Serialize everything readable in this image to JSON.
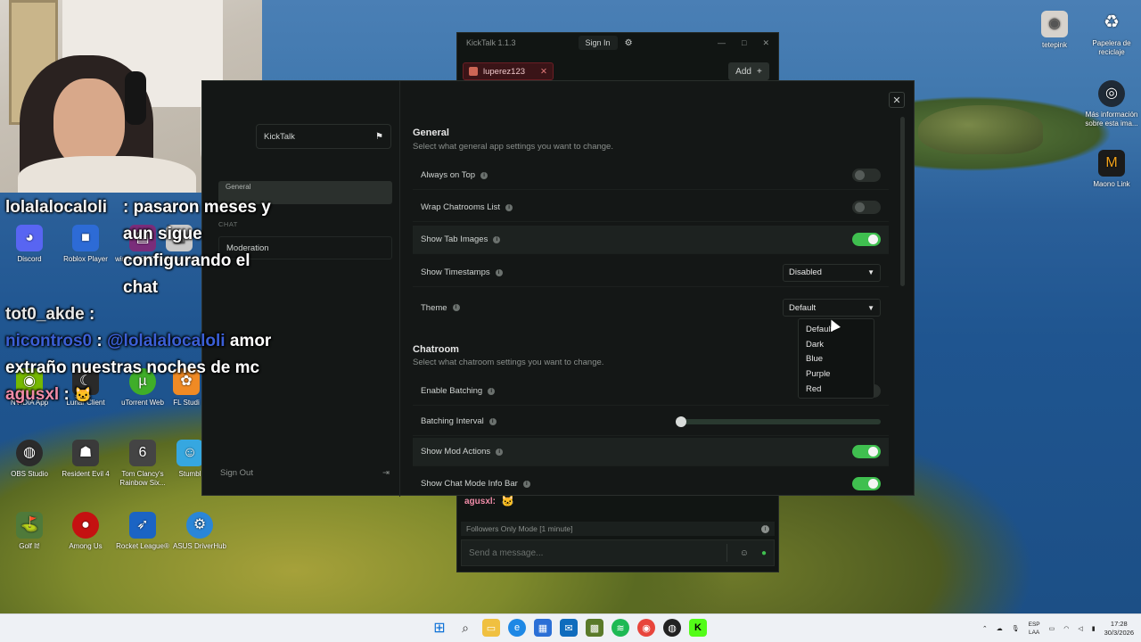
{
  "stream_chat": {
    "messages": [
      {
        "user": "lolalalocaloli",
        "text": " : pasaron meses y aun sigue configurando el chat"
      },
      {
        "user": "tot0_akde",
        "text": " :"
      },
      {
        "user": "nicontros0",
        "text": " : ",
        "mention": "@lolalalocaloli",
        "rest": " amor extraño nuestras noches de mc"
      },
      {
        "user": "agusxl",
        "text": " :"
      }
    ]
  },
  "desktop_icons": [
    {
      "label": "tetepink"
    },
    {
      "label": "Papelera de reciclaje"
    },
    {
      "label": "Más información sobre esta ima..."
    },
    {
      "label": "Maono Link"
    },
    {
      "label": "Discord"
    },
    {
      "label": "Roblox Player"
    },
    {
      "label": "winrar-x64-713es"
    },
    {
      "label": "licenseva"
    },
    {
      "label": "NVIDIA App"
    },
    {
      "label": "Lunar Client"
    },
    {
      "label": "uTorrent Web"
    },
    {
      "label": "FL Studi"
    },
    {
      "label": "OBS Studio"
    },
    {
      "label": "Resident Evil 4"
    },
    {
      "label": "Tom Clancy's Rainbow Six..."
    },
    {
      "label": "Stumbl"
    },
    {
      "label": "Golf It!"
    },
    {
      "label": "Among Us"
    },
    {
      "label": "Rocket League®"
    },
    {
      "label": "ASUS DriverHub"
    }
  ],
  "kicktalk_window": {
    "title": "KickTalk 1.1.3",
    "sign_in": "Sign In",
    "tab_label": "luperez123",
    "add_label": "Add",
    "last_message_user": "agusxl:",
    "info_bar": "Followers Only Mode [1 minute]",
    "message_placeholder": "Send a message..."
  },
  "settings": {
    "brand": "KickTalk",
    "sidebar_general": "General",
    "sidebar_chat_label": "CHAT",
    "sidebar_moderation": "Moderation",
    "sign_out": "Sign Out",
    "general": {
      "title": "General",
      "description": "Select what general app settings you want to change.",
      "rows": [
        {
          "label": "Always on Top",
          "type": "toggle",
          "on": false
        },
        {
          "label": "Wrap Chatrooms List",
          "type": "toggle",
          "on": false
        },
        {
          "label": "Show Tab Images",
          "type": "toggle",
          "on": true
        },
        {
          "label": "Show Timestamps",
          "type": "select",
          "value": "Disabled"
        },
        {
          "label": "Theme",
          "type": "select",
          "value": "Default"
        }
      ]
    },
    "chatroom": {
      "title": "Chatroom",
      "description": "Select what chatroom settings you want to change.",
      "rows": [
        {
          "label": "Enable Batching",
          "type": "toggle",
          "on": false
        },
        {
          "label": "Batching Interval",
          "type": "slider",
          "value": 0
        },
        {
          "label": "Show Mod Actions",
          "type": "toggle",
          "on": true
        },
        {
          "label": "Show Chat Mode Info Bar",
          "type": "toggle",
          "on": true
        }
      ]
    },
    "theme_options": [
      "Default",
      "Dark",
      "Blue",
      "Purple",
      "Red"
    ]
  },
  "taskbar": {
    "language_top": "ESP",
    "language_bottom": "LAA",
    "time": "17:28",
    "date": "30/3/2026"
  },
  "colors": {
    "toggle_on": "#3fbf4f",
    "tab_accent": "#6b1e24",
    "mention": "#3b5fd6",
    "agusxl": "#f08ca8"
  }
}
